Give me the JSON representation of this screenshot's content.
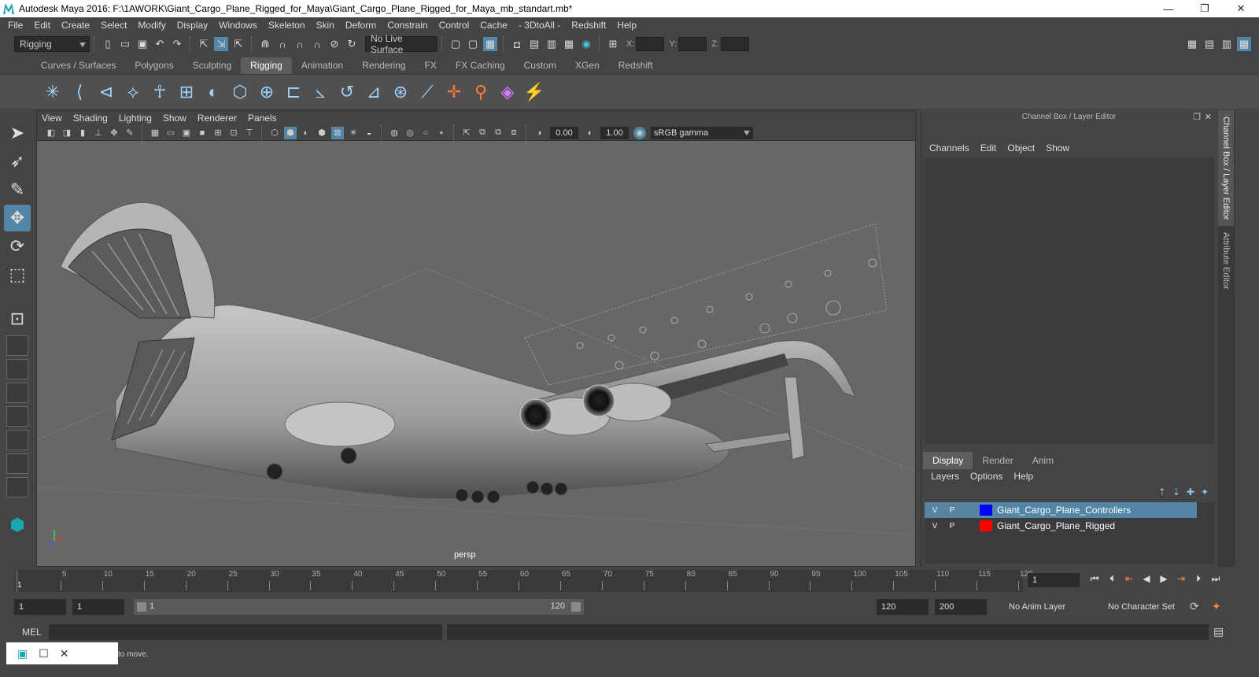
{
  "window": {
    "title": "Autodesk Maya 2016: F:\\1AWORK\\Giant_Cargo_Plane_Rigged_for_Maya\\Giant_Cargo_Plane_Rigged_for_Maya_mb_standart.mb*",
    "minimize": "—",
    "maximize": "❐",
    "close": "✕"
  },
  "menubar": [
    "File",
    "Edit",
    "Create",
    "Select",
    "Modify",
    "Display",
    "Windows",
    "Skeleton",
    "Skin",
    "Deform",
    "Constrain",
    "Control",
    "Cache",
    "- 3DtoAll -",
    "Redshift",
    "Help"
  ],
  "statusline": {
    "menuset": "Rigging",
    "live_surface": "No Live Surface",
    "x_label": "X:",
    "y_label": "Y:",
    "z_label": "Z:"
  },
  "shelf_tabs": [
    "Curves / Surfaces",
    "Polygons",
    "Sculpting",
    "Rigging",
    "Animation",
    "Rendering",
    "FX",
    "FX Caching",
    "Custom",
    "XGen",
    "Redshift"
  ],
  "shelf_active": "Rigging",
  "viewport": {
    "menu": [
      "View",
      "Shading",
      "Lighting",
      "Show",
      "Renderer",
      "Panels"
    ],
    "exposure": "0.00",
    "gamma": "1.00",
    "color_space": "sRGB gamma",
    "camera": "persp"
  },
  "channel_box": {
    "title": "Channel Box / Layer Editor",
    "menu": [
      "Channels",
      "Edit",
      "Object",
      "Show"
    ],
    "layer_tabs": [
      "Display",
      "Render",
      "Anim"
    ],
    "layer_menu": [
      "Layers",
      "Options",
      "Help"
    ],
    "layers": [
      {
        "v": "V",
        "p": "P",
        "color": "#0000ff",
        "name": "Giant_Cargo_Plane_Controllers",
        "selected": true
      },
      {
        "v": "V",
        "p": "P",
        "color": "#ff0000",
        "name": "Giant_Cargo_Plane_Rigged",
        "selected": false
      }
    ]
  },
  "side_tabs": [
    "Channel Box / Layer Editor",
    "Attribute Editor"
  ],
  "timeslider": {
    "ticks": [
      "5",
      "10",
      "15",
      "20",
      "25",
      "30",
      "35",
      "40",
      "45",
      "50",
      "55",
      "60",
      "65",
      "70",
      "75",
      "80",
      "85",
      "90",
      "95",
      "100",
      "105",
      "110",
      "115",
      "120"
    ],
    "start_tick": "1",
    "current_frame": "1"
  },
  "range": {
    "start": "1",
    "start_anim": "1",
    "slider_start": "1",
    "slider_end": "120",
    "end": "120",
    "end_anim": "200",
    "anim_layer": "No Anim Layer",
    "character_set": "No Character Set"
  },
  "cmdline": {
    "label": "MEL"
  },
  "helpline": {
    "message": "to move."
  }
}
